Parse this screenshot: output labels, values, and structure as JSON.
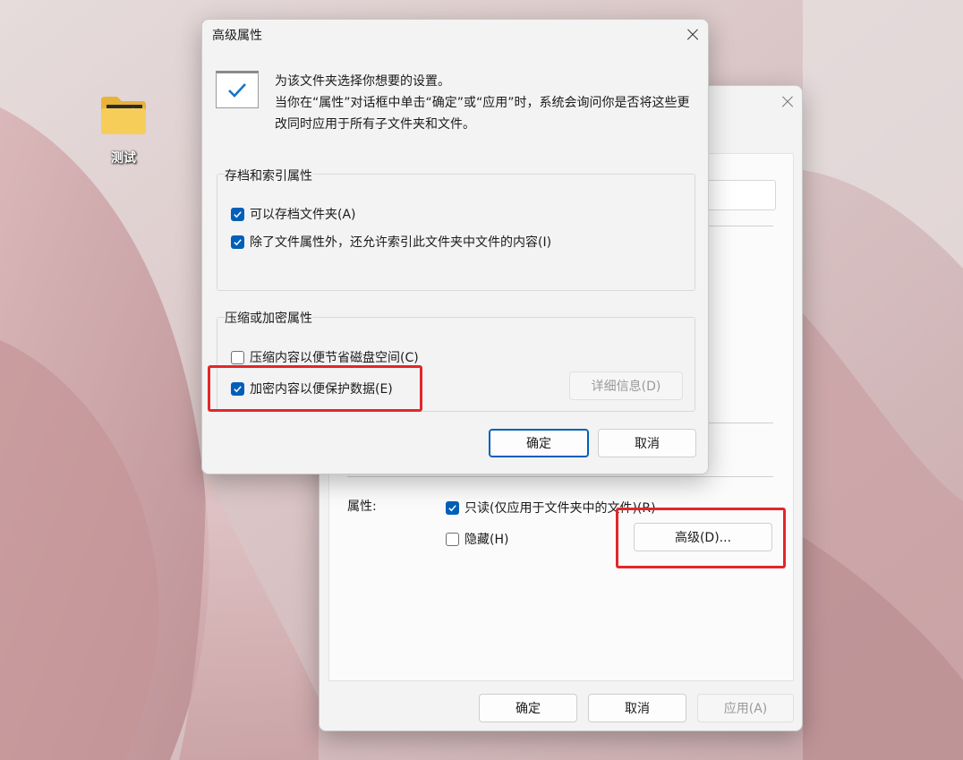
{
  "desktop": {
    "icon_label": "测试",
    "icon_name": "folder-icon"
  },
  "properties_window": {
    "attributes_label": "属性:",
    "readonly_label": "只读(仅应用于文件夹中的文件)(R)",
    "readonly_checked": true,
    "hidden_label": "隐藏(H)",
    "hidden_checked": false,
    "advanced_button": "高级(D)...",
    "ok_button": "确定",
    "cancel_button": "取消",
    "apply_button": "应用(A)"
  },
  "advanced_dialog": {
    "title": "高级属性",
    "intro_line1": "为该文件夹选择你想要的设置。",
    "intro_line2": "当你在“属性”对话框中单击“确定”或“应用”时，系统会询问你是否将这些更改同时应用于所有子文件夹和文件。",
    "archive_group": {
      "title": "存档和索引属性",
      "archive_label": "可以存档文件夹(A)",
      "archive_checked": true,
      "index_label": "除了文件属性外，还允许索引此文件夹中文件的内容(I)",
      "index_checked": true
    },
    "compress_group": {
      "title": "压缩或加密属性",
      "compress_label": "压缩内容以便节省磁盘空间(C)",
      "compress_checked": false,
      "encrypt_label": "加密内容以便保护数据(E)",
      "encrypt_checked": true,
      "details_button": "详细信息(D)"
    },
    "ok_button": "确定",
    "cancel_button": "取消"
  },
  "colors": {
    "accent": "#005fb8",
    "highlight": "#e3262b"
  }
}
